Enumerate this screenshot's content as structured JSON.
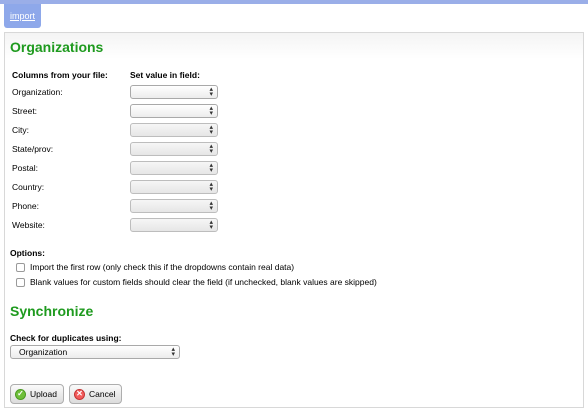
{
  "tab": {
    "label": "import"
  },
  "section_org": {
    "title": "Organizations"
  },
  "columns": {
    "left_header": "Columns from your file:",
    "right_header": "Set value in field:"
  },
  "fields": [
    {
      "label": "Organization:"
    },
    {
      "label": "Street:"
    },
    {
      "label": "City:"
    },
    {
      "label": "State/prov:"
    },
    {
      "label": "Postal:"
    },
    {
      "label": "Country:"
    },
    {
      "label": "Phone:"
    },
    {
      "label": "Website:"
    }
  ],
  "options": {
    "title": "Options:",
    "import_first_row": "Import the first row (only check this if the dropdowns contain real data)",
    "blank_clear": "Blank values for custom fields should clear the field (if unchecked, blank values are skipped)"
  },
  "section_sync": {
    "title": "Synchronize"
  },
  "duplicates": {
    "label": "Check for duplicates using:",
    "selected": "Organization"
  },
  "buttons": {
    "upload": "Upload",
    "cancel": "Cancel"
  }
}
